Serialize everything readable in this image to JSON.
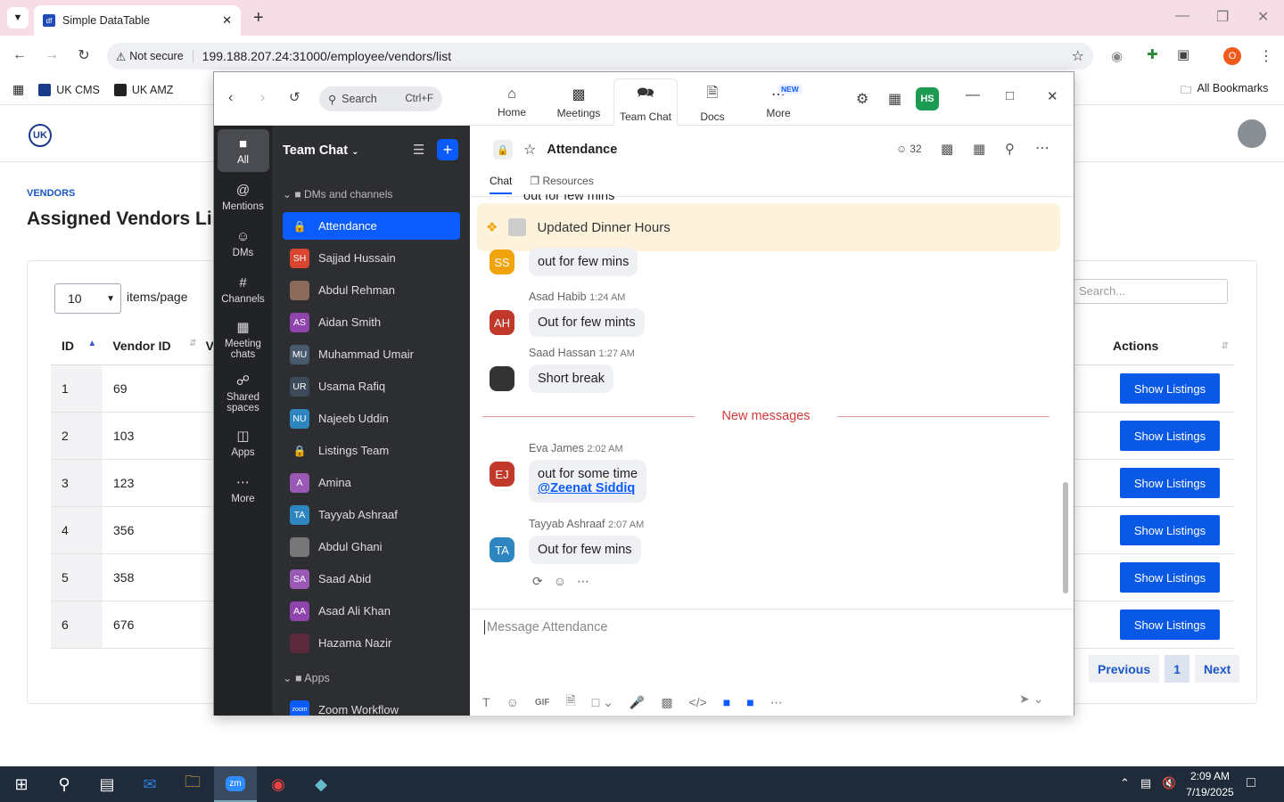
{
  "browser": {
    "tab_title": "Simple DataTable",
    "favicon_text": "df",
    "not_secure": "Not secure",
    "url": "199.188.207.24:31000/employee/vendors/list",
    "bookmarks": [
      "UK CMS",
      "UK AMZ"
    ],
    "all_bookmarks": "All Bookmarks",
    "profile_letter": "O"
  },
  "page": {
    "logo_text": "UK",
    "breadcrumb": "VENDORS",
    "title": "Assigned Vendors Listing",
    "per_page_value": "10",
    "per_page_label": "items/page",
    "search_placeholder": "Search...",
    "columns": {
      "id": "ID",
      "vendor_id": "Vendor ID",
      "partial": "V",
      "actions": "Actions"
    },
    "rows": [
      {
        "id": "1",
        "vendor_id": "69"
      },
      {
        "id": "2",
        "vendor_id": "103"
      },
      {
        "id": "3",
        "vendor_id": "123"
      },
      {
        "id": "4",
        "vendor_id": "356"
      },
      {
        "id": "5",
        "vendor_id": "358"
      },
      {
        "id": "6",
        "vendor_id": "676"
      }
    ],
    "action_label": "Show Listings",
    "pager": {
      "prev": "Previous",
      "page": "1",
      "next": "Next"
    }
  },
  "zoom": {
    "search_label": "Search",
    "search_shortcut": "Ctrl+F",
    "tabs": [
      "Home",
      "Meetings",
      "Team Chat",
      "Docs",
      "More"
    ],
    "new_badge": "NEW",
    "user_initials": "HS",
    "rail": [
      "All",
      "Mentions",
      "DMs",
      "Channels",
      "Meeting chats",
      "Shared spaces",
      "Apps",
      "More"
    ],
    "panel_title": "Team Chat",
    "section_dms": "DMs and channels",
    "section_apps": "Apps",
    "channels": [
      {
        "name": "Attendance",
        "initials": "",
        "color": "#0b5cff"
      },
      {
        "name": "Sajjad Hussain",
        "initials": "SH",
        "color": "#d9452f"
      },
      {
        "name": "Abdul Rehman",
        "initials": "",
        "color": "#8a6a5a"
      },
      {
        "name": "Aidan Smith",
        "initials": "AS",
        "color": "#8e44ad"
      },
      {
        "name": "Muhammad Umair",
        "initials": "MU",
        "color": "#4a5a6e"
      },
      {
        "name": "Usama Rafiq",
        "initials": "UR",
        "color": "#3d4a5a"
      },
      {
        "name": "Najeeb Uddin",
        "initials": "NU",
        "color": "#2e86c1"
      },
      {
        "name": "Listings Team",
        "initials": "",
        "color": "#55575c"
      },
      {
        "name": "Amina",
        "initials": "A",
        "color": "#9b59b6"
      },
      {
        "name": "Tayyab Ashraaf",
        "initials": "TA",
        "color": "#2e86c1"
      },
      {
        "name": "Abdul Ghani",
        "initials": "",
        "color": "#777"
      },
      {
        "name": "Saad Abid",
        "initials": "SA",
        "color": "#9b59b6"
      },
      {
        "name": "Asad Ali Khan",
        "initials": "AA",
        "color": "#8e44ad"
      },
      {
        "name": "Hazama Nazir",
        "initials": "",
        "color": "#5a2a3a"
      }
    ],
    "app_zoom_workflow": "Zoom Workflow",
    "channel_name": "Attendance",
    "member_count": "32",
    "chat_tabs": [
      "Chat",
      "Resources"
    ],
    "pinned": "Updated Dinner Hours",
    "cut_message": "out for few mins",
    "messages": [
      {
        "initials": "SS",
        "color": "#f0a30a",
        "author": "",
        "time": "",
        "text": "out for few mins"
      },
      {
        "initials": "AH",
        "color": "#c0392b",
        "author": "Asad Habib",
        "time": "1:24 AM",
        "text": "Out for few mints"
      },
      {
        "initials": "",
        "color": "#333",
        "author": "Saad Hassan",
        "time": "1:27 AM",
        "text": "Short break"
      },
      {
        "initials": "EJ",
        "color": "#c0392b",
        "author": "Eva James",
        "time": "2:02 AM",
        "text": "out for some time",
        "mention": "@Zeenat Siddiq"
      },
      {
        "initials": "TA",
        "color": "#2e86c1",
        "author": "Tayyab Ashraaf",
        "time": "2:07 AM",
        "text": "Out for few mins"
      }
    ],
    "new_messages": "New messages",
    "composer_placeholder": "Message Attendance"
  },
  "taskbar": {
    "time": "2:09 AM",
    "date": "7/19/2025"
  }
}
